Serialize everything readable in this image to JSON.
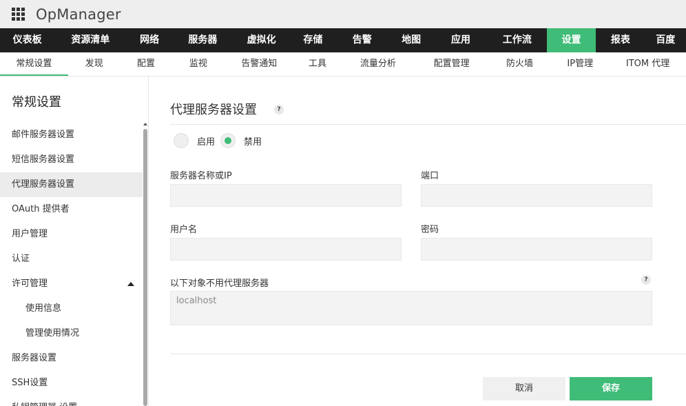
{
  "app": {
    "title": "OpManager"
  },
  "main_nav": [
    {
      "label": "仪表板",
      "w": 80
    },
    {
      "label": "资源清单",
      "w": 105
    },
    {
      "label": "网络",
      "w": 68
    },
    {
      "label": "服务器",
      "w": 88
    },
    {
      "label": "虚拟化",
      "w": 84
    },
    {
      "label": "存储",
      "w": 67
    },
    {
      "label": "告警",
      "w": 77
    },
    {
      "label": "地图",
      "w": 67
    },
    {
      "label": "应用",
      "w": 78
    },
    {
      "label": "工作流",
      "w": 87
    },
    {
      "label": "设置",
      "w": 72,
      "active": true
    },
    {
      "label": "报表",
      "w": 72
    },
    {
      "label": "百度",
      "w": 60
    }
  ],
  "sub_nav": [
    {
      "label": "常规设置",
      "w": 99,
      "active": true
    },
    {
      "label": "发现",
      "w": 76
    },
    {
      "label": "配置",
      "w": 75
    },
    {
      "label": "监视",
      "w": 77
    },
    {
      "label": "告警通知",
      "w": 100
    },
    {
      "label": "工具",
      "w": 70
    },
    {
      "label": "流量分析",
      "w": 106
    },
    {
      "label": "配置管理",
      "w": 108
    },
    {
      "label": "防火墙",
      "w": 90
    },
    {
      "label": "IP管理",
      "w": 86
    },
    {
      "label": "ITOM 代理",
      "w": 111
    }
  ],
  "sidebar": {
    "title": "常规设置",
    "items": [
      {
        "label": "邮件服务器设置"
      },
      {
        "label": "短信服务器设置"
      },
      {
        "label": "代理服务器设置",
        "active": true
      },
      {
        "label": "OAuth 提供者"
      },
      {
        "label": "用户管理"
      },
      {
        "label": "认证"
      },
      {
        "label": "许可管理",
        "expanded": true
      },
      {
        "label": "使用信息",
        "sub": true
      },
      {
        "label": "管理使用情况",
        "sub": true
      },
      {
        "label": "服务器设置"
      },
      {
        "label": "SSH设置"
      },
      {
        "label": "私钥管理器 设置"
      }
    ]
  },
  "content": {
    "title": "代理服务器设置",
    "help_glyph": "?",
    "radio": {
      "enable_label": "启用",
      "disable_label": "禁用",
      "selected": "disable"
    },
    "fields": {
      "server_label": "服务器名称或IP",
      "server_value": "",
      "port_label": "端口",
      "port_value": "",
      "username_label": "用户名",
      "username_value": "",
      "password_label": "密码",
      "password_value": "",
      "bypass_label": "以下对象不用代理服务器",
      "bypass_value": "localhost"
    },
    "buttons": {
      "cancel": "取消",
      "save": "保存"
    }
  },
  "colors": {
    "accent": "#3fbc78",
    "nav_bg": "#1f1f1f",
    "appbar_bg": "#eeeeee"
  }
}
